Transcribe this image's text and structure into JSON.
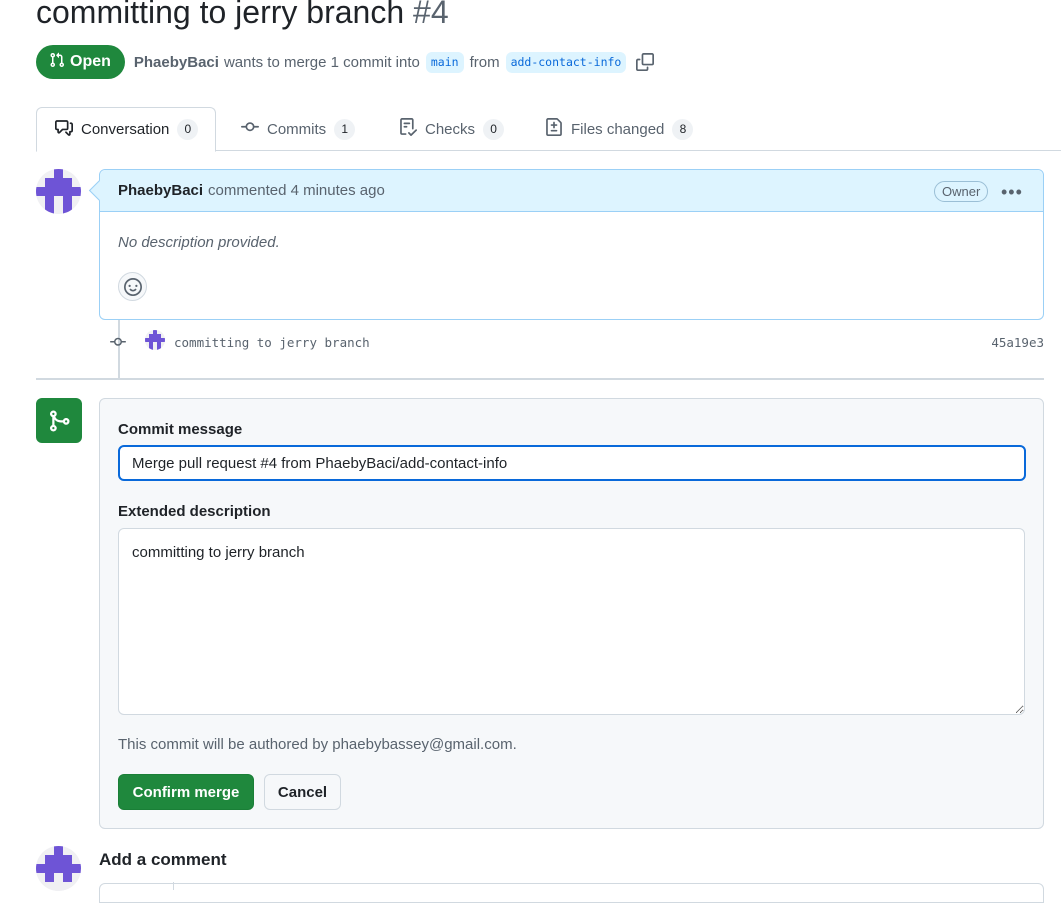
{
  "pr": {
    "title": "committing to jerry branch",
    "number": "#4",
    "state": "Open",
    "author": "PhaebyBaci",
    "merge_text": "wants to merge 1 commit into",
    "base_branch": "main",
    "from_text": "from",
    "head_branch": "add-contact-info"
  },
  "tabs": [
    {
      "label": "Conversation",
      "count": "0"
    },
    {
      "label": "Commits",
      "count": "1"
    },
    {
      "label": "Checks",
      "count": "0"
    },
    {
      "label": "Files changed",
      "count": "8"
    }
  ],
  "comment": {
    "author": "PhaebyBaci",
    "action": "commented 4 minutes ago",
    "badge": "Owner",
    "body": "No description provided."
  },
  "commit": {
    "message": "committing to jerry branch",
    "sha": "45a19e3"
  },
  "merge": {
    "commit_message_label": "Commit message",
    "commit_message_value": "Merge pull request #4 from PhaebyBaci/add-contact-info",
    "extended_label": "Extended description",
    "extended_value": "committing to jerry branch",
    "author_note": "This commit will be authored by phaebybassey@gmail.com.",
    "confirm_label": "Confirm merge",
    "cancel_label": "Cancel"
  },
  "add_comment": {
    "heading": "Add a comment"
  },
  "icons": {
    "state": "git-pull-request-icon",
    "copy": "copy-icon",
    "conversation": "comment-discussion-icon",
    "commits": "git-commit-icon",
    "checks": "checklist-icon",
    "files": "file-diff-icon",
    "reaction": "smiley-icon",
    "kebab": "kebab-horizontal-icon",
    "merge": "git-merge-icon"
  },
  "colors": {
    "open_green": "#1f883d",
    "link_blue": "#0969da",
    "comment_header_bg": "#ddf4ff",
    "muted_text": "#59636e",
    "avatar_purple": "#6e54d6"
  }
}
